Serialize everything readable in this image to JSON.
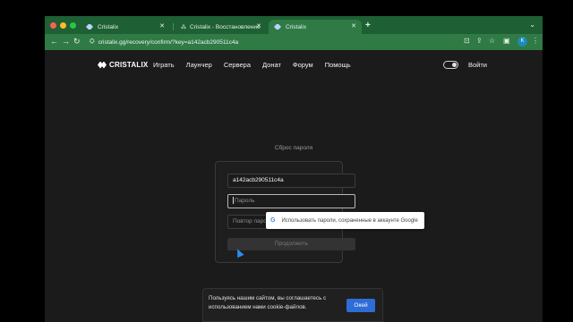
{
  "browser": {
    "tabs": [
      {
        "title": "Cristalix",
        "icon": "cristalix-favicon"
      },
      {
        "title": "Cristalix - Восстановление п...",
        "icon": "ai-favicon"
      },
      {
        "title": "Cristalix",
        "icon": "cristalix-favicon",
        "active": true
      }
    ],
    "url": "cristalix.gg/recovery/confirm/?key=a142acb290511c4a",
    "profile_initial": "K"
  },
  "site": {
    "logo_text": "CRISTALIX",
    "nav": [
      "Играть",
      "Лаунчер",
      "Сервера",
      "Донат",
      "Форум",
      "Помощь"
    ],
    "login_label": "Войти"
  },
  "form": {
    "title": "Сброс пароля",
    "key_value": "a142acb290511c4a",
    "password_placeholder": "Пароль",
    "repeat_placeholder": "Повтор пароля",
    "submit_label": "Продолжить"
  },
  "autofill": {
    "text": "Использовать пароли, сохраненные в аккаунте Google"
  },
  "cookie": {
    "text": "Пользуясь нашим сайтом, вы соглашаетесь с использованием нами cookie-файлов.",
    "button_label": "Окей"
  },
  "colors": {
    "chrome_green": "#2f7a45",
    "tabbar_green": "#1e5f34",
    "page_bg": "#1b1b1b",
    "accent_blue": "#2f6cd6"
  }
}
